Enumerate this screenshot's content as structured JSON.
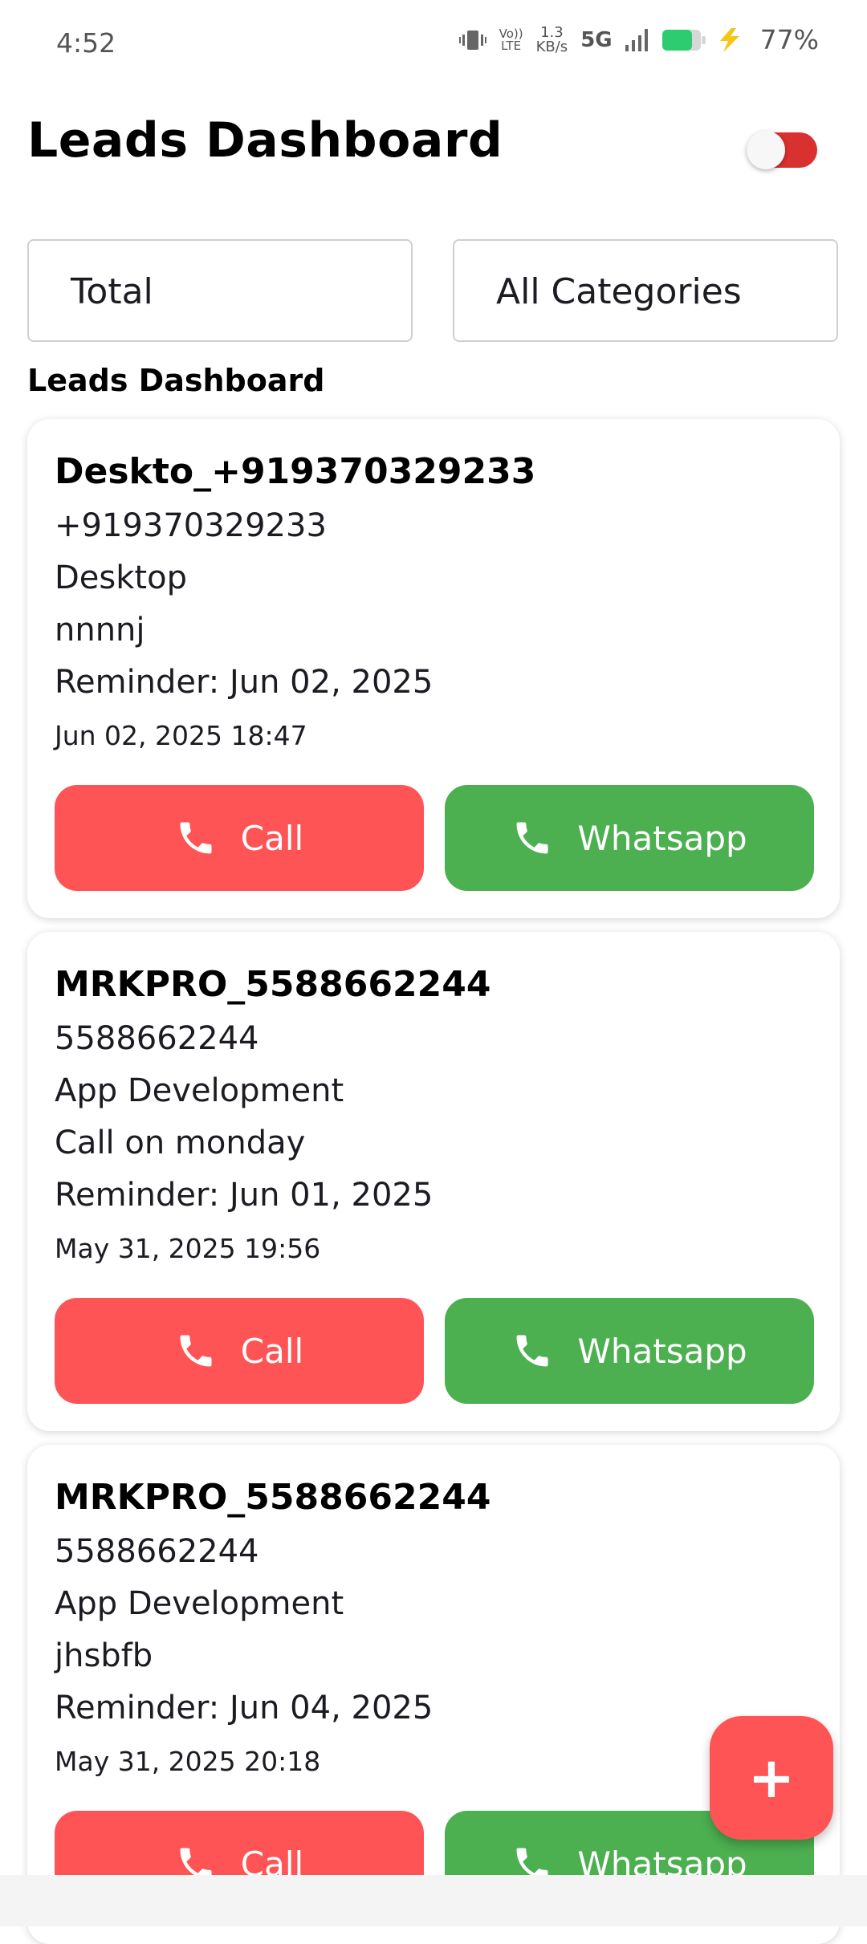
{
  "status_bar": {
    "time": "4:52",
    "volte": "Vo)) LTE",
    "speed_value": "1.3",
    "speed_unit": "KB/s",
    "network": "5G",
    "battery_percent": "77%",
    "battery_level": 0.77,
    "icons": [
      "vibrate-icon",
      "volte-icon",
      "signal-icon",
      "battery-icon",
      "charging-icon"
    ]
  },
  "header": {
    "title": "Leads Dashboard",
    "toggle_on": true,
    "toggle_color": "#d93030"
  },
  "filters": {
    "status_select": "Total",
    "category_select": "All Categories"
  },
  "section_heading": "Leads Dashboard",
  "leads": [
    {
      "name": "Deskto_+919370329233",
      "phone": "+919370329233",
      "category": "Desktop",
      "note": "nnnnj",
      "reminder": "Reminder: Jun 02, 2025",
      "created": "Jun 02, 2025 18:47",
      "call_label": "Call",
      "whatsapp_label": "Whatsapp"
    },
    {
      "name": "MRKPRO_5588662244",
      "phone": "5588662244",
      "category": "App Development",
      "note": "Call on monday",
      "reminder": "Reminder: Jun 01, 2025",
      "created": "May 31, 2025 19:56",
      "call_label": "Call",
      "whatsapp_label": "Whatsapp"
    },
    {
      "name": "MRKPRO_5588662244",
      "phone": "5588662244",
      "category": "App Development",
      "note": "jhsbfb",
      "reminder": "Reminder: Jun 04, 2025",
      "created": "May 31, 2025 20:18",
      "call_label": "Call",
      "whatsapp_label": "Whatsapp"
    }
  ],
  "fab": {
    "label": "+",
    "icon": "plus-icon"
  },
  "colors": {
    "call": "#ff5455",
    "whatsapp": "#4caf50",
    "fab": "#ff5455"
  }
}
